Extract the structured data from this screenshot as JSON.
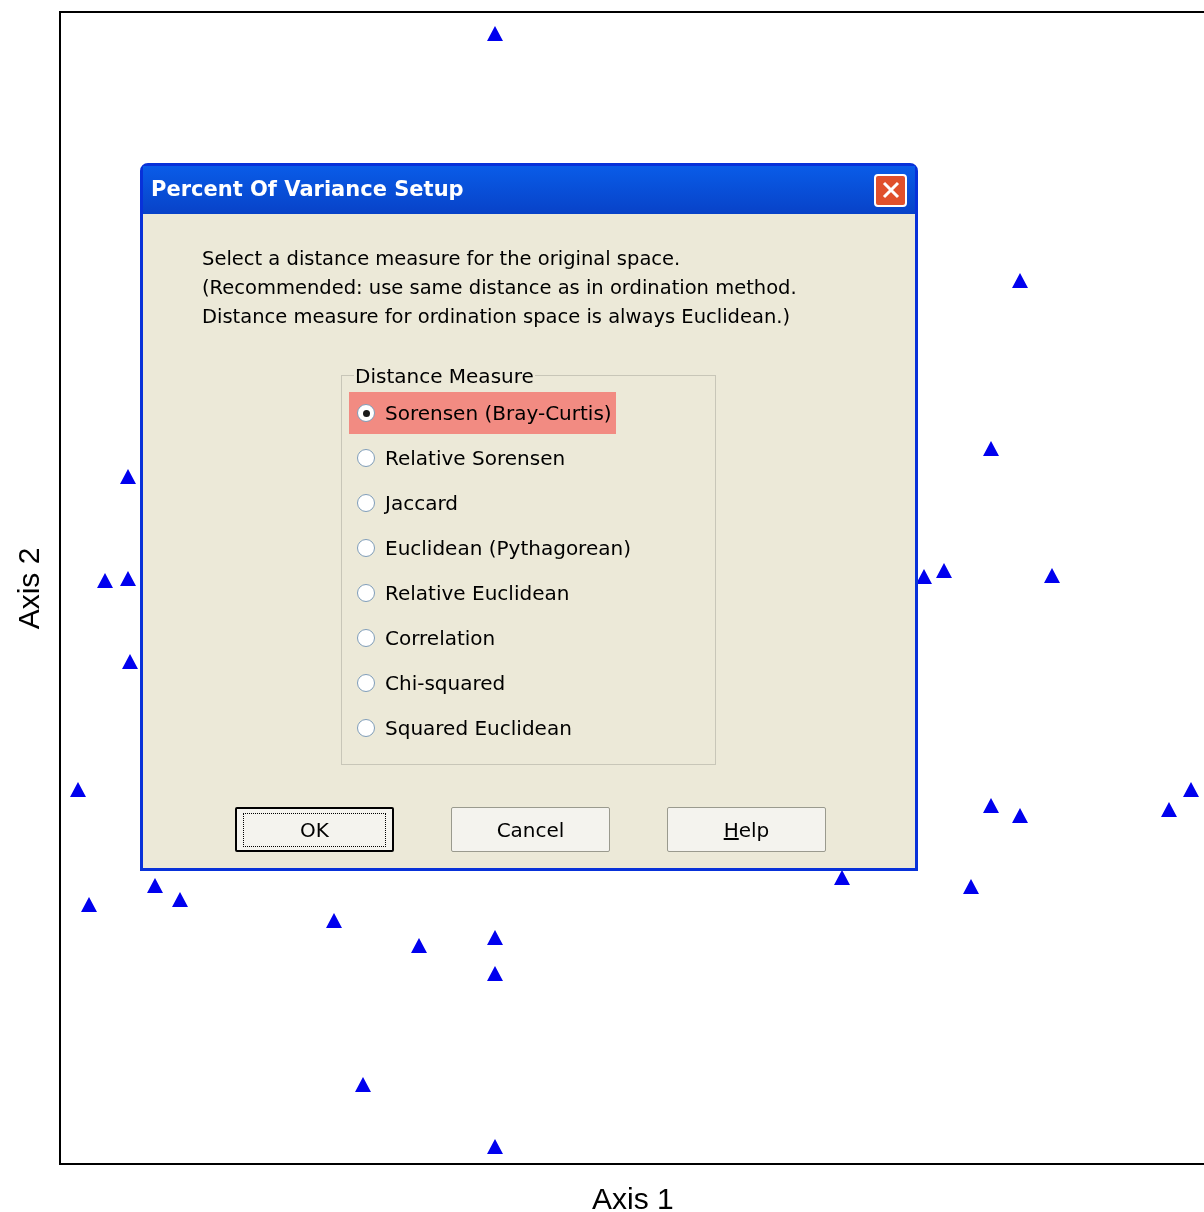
{
  "plot": {
    "xlabel": "Axis 1",
    "ylabel": "Axis 2"
  },
  "dialog": {
    "title": "Percent Of Variance Setup",
    "instructions": [
      "Select a distance measure for the original space.",
      "(Recommended: use same distance as in ordination method.",
      "Distance measure for ordination space is always Euclidean.)"
    ],
    "group": {
      "label": "Distance Measure",
      "options": [
        {
          "label": "Sorensen (Bray-Curtis)",
          "selected": true
        },
        {
          "label": "Relative Sorensen",
          "selected": false
        },
        {
          "label": "Jaccard",
          "selected": false
        },
        {
          "label": "Euclidean (Pythagorean)",
          "selected": false
        },
        {
          "label": "Relative Euclidean",
          "selected": false
        },
        {
          "label": "Correlation",
          "selected": false
        },
        {
          "label": "Chi-squared",
          "selected": false
        },
        {
          "label": "Squared Euclidean",
          "selected": false
        }
      ]
    },
    "buttons": [
      {
        "label": "OK",
        "focused": true,
        "underline_first": false
      },
      {
        "label": "Cancel",
        "focused": false,
        "underline_first": false
      },
      {
        "label": "Help",
        "focused": false,
        "underline_first": true
      }
    ]
  }
}
